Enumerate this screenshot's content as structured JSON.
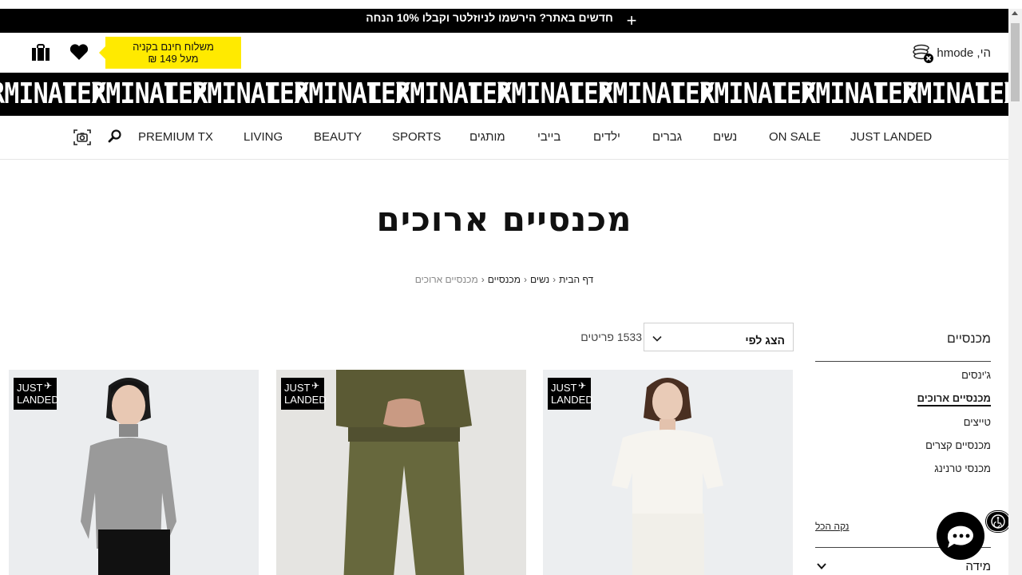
{
  "promo": {
    "text": "חדשים באתר? הירשמו לניוזלטר וקבלו 10% הנחה",
    "expand_symbol": "+"
  },
  "header": {
    "shipping_line1": "משלוח חינם בקניה",
    "shipping_line2": "מעל 149 ₪",
    "greeting": "הי, hmode",
    "icons": [
      "bag-icon",
      "heart-icon",
      "coins-icon"
    ]
  },
  "brand": {
    "logo_text": "TERMINAL X"
  },
  "nav": {
    "items": [
      "JUST LANDED",
      "ON SALE",
      "נשים",
      "גברים",
      "ילדים",
      "בייבי",
      "מותגים",
      "SPORTS",
      "BEAUTY",
      "LIVING",
      "PREMIUM TX"
    ]
  },
  "page": {
    "title": "מכנסיים ארוכים"
  },
  "breadcrumb": {
    "items": [
      "דף הבית",
      "נשים",
      "מכנסיים",
      "מכנסיים ארוכים"
    ]
  },
  "toolbar": {
    "count": "1533 פריטים",
    "sort_label": "הצג לפי"
  },
  "sidebar": {
    "title": "מכנסיים",
    "items": [
      "ג'ינסים",
      "מכנסיים ארוכים",
      "טייצים",
      "מכנסיים קצרים",
      "מכנסי טרנינג"
    ],
    "active_index": 1,
    "clear_all": "נקה הכל",
    "size_title": "מידה"
  },
  "products": [
    {
      "badge_line1": "JUST",
      "badge_line2": "LANDED"
    },
    {
      "badge_line1": "JUST",
      "badge_line2": "LANDED"
    },
    {
      "badge_line1": "JUST",
      "badge_line2": "LANDED"
    }
  ],
  "colors": {
    "promo_bg": "#000000",
    "shipping_badge": "#ffea00",
    "brand_bar": "#000000"
  }
}
